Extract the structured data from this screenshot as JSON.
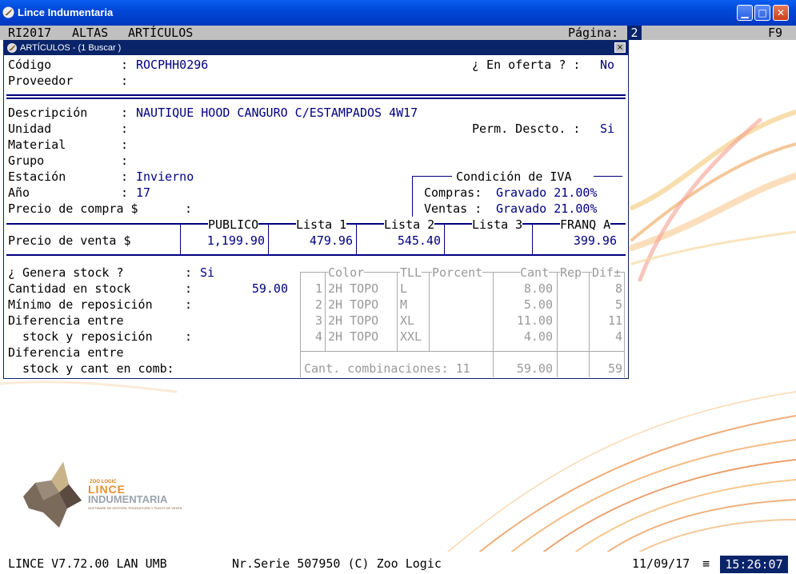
{
  "app": {
    "title": "Lince Indumentaria",
    "controls": {
      "minimize": "minimize-icon",
      "maximize": "maximize-icon",
      "close": "close-icon"
    }
  },
  "menubar": {
    "items": [
      "RI2017",
      "ALTAS",
      "ARTÍCULOS"
    ],
    "page_label": "Página:",
    "page_value": "2",
    "key": "F9"
  },
  "window": {
    "title": "ARTÍCULOS - (1  Buscar )",
    "close": "×"
  },
  "form": {
    "codigo_label": "Código",
    "codigo_value": "ROCPHH0296",
    "oferta_label": "¿ En oferta ? :",
    "oferta_value": "No",
    "proveedor_label": "Proveedor",
    "descripcion_label": "Descripción",
    "descripcion_value": "NAUTIQUE HOOD CANGURO C/ESTAMPADOS 4W17",
    "unidad_label": "Unidad",
    "perm_label": "Perm. Descto. :",
    "perm_value": "Si",
    "material_label": "Material",
    "grupo_label": "Grupo",
    "estacion_label": "Estación",
    "estacion_value": "Invierno",
    "anio_label": "Año",
    "anio_value": "17",
    "precio_compra_label": "Precio de compra $",
    "colon": ":",
    "iva_title": "Condición de IVA",
    "compras_label": "Compras:",
    "compras_value": "Gravado 21.00%",
    "ventas_label": "Ventas :",
    "ventas_value": "Gravado 21.00%",
    "precio_venta_label": "Precio de venta $",
    "price_headers": [
      "PUBLICO",
      "Lista 1",
      "Lista 2",
      "Lista 3",
      "FRANQ A"
    ],
    "price_values": [
      "1,199.90",
      "479.96",
      "545.40",
      "",
      "399.96"
    ],
    "genera_label": "¿ Genera stock ?",
    "genera_value": "Si",
    "cantidad_label": "Cantidad en stock",
    "cantidad_value": "59.00",
    "minimo_label": "Mínimo de reposición",
    "diferencia1_label": "Diferencia entre",
    "diferencia1b_label": "  stock y reposición",
    "diferencia2_label": "Diferencia entre",
    "diferencia2b_label": "  stock y cant en comb:"
  },
  "combo_table": {
    "headers": [
      "Color",
      "TLL",
      "Porcent",
      "Cant",
      "Rep",
      "Dif±"
    ],
    "rows": [
      {
        "n": "1",
        "color": "2H TOPO",
        "tll": "L",
        "porcent": "",
        "cant": "8.00",
        "rep": "",
        "dif": "8"
      },
      {
        "n": "2",
        "color": "2H TOPO",
        "tll": "M",
        "porcent": "",
        "cant": "5.00",
        "rep": "",
        "dif": "5"
      },
      {
        "n": "3",
        "color": "2H TOPO",
        "tll": "XL",
        "porcent": "",
        "cant": "11.00",
        "rep": "",
        "dif": "11"
      },
      {
        "n": "4",
        "color": "2H TOPO",
        "tll": "XXL",
        "porcent": "",
        "cant": "4.00",
        "rep": "",
        "dif": "4"
      }
    ],
    "footer_label": "Cant. combinaciones: 11",
    "footer_cant": "59.00",
    "footer_dif": "59"
  },
  "logo": {
    "brand_small": "ZOO LOGIC",
    "brand_line1": "LINCE",
    "brand_line2": "INDUMENTARIA",
    "tagline": "SOFTWARE DE GESTIÓN, PRODUCCIÓN Y PUNTO DE VENTA"
  },
  "statusbar": {
    "version": "LINCE  V7.72.00 LAN UMB",
    "serial": "Nr.Serie 507950 (C) Zoo Logic",
    "date": "11/09/17",
    "sep": "≡",
    "time": "15:26:07"
  },
  "colors": {
    "titlebar": "#0047d8",
    "menubar": "#c0c0c0",
    "field_value": "#00007f",
    "grid": "#a8a8a8",
    "clock_bg": "#0a246a"
  }
}
